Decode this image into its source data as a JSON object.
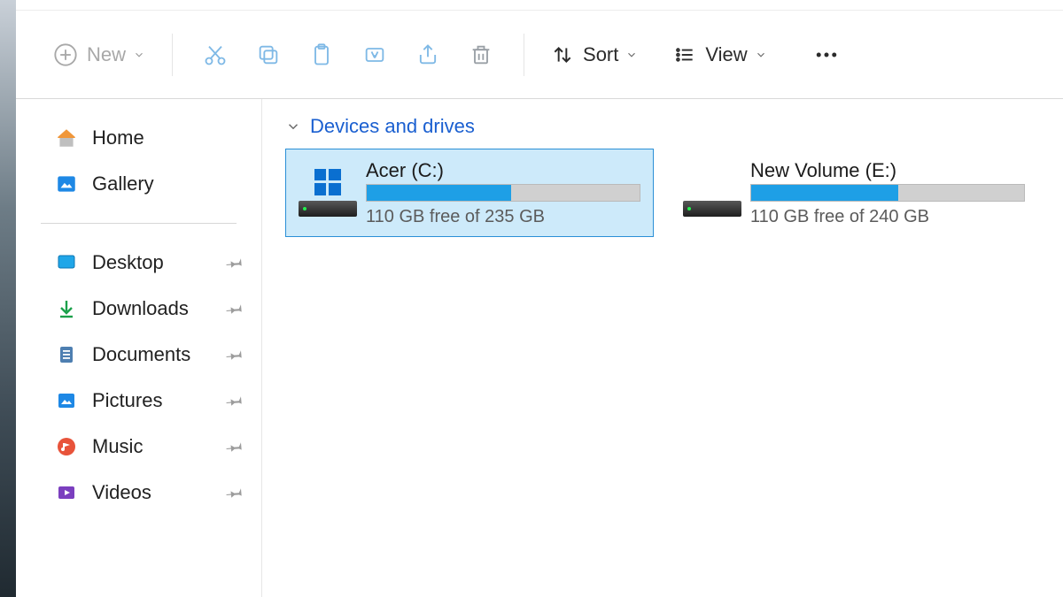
{
  "toolbar": {
    "new_label": "New",
    "sort_label": "Sort",
    "view_label": "View"
  },
  "sidebar": {
    "top": [
      {
        "label": "Home"
      },
      {
        "label": "Gallery"
      }
    ],
    "pinned": [
      {
        "label": "Desktop"
      },
      {
        "label": "Downloads"
      },
      {
        "label": "Documents"
      },
      {
        "label": "Pictures"
      },
      {
        "label": "Music"
      },
      {
        "label": "Videos"
      }
    ]
  },
  "content": {
    "group_title": "Devices and drives",
    "drives": [
      {
        "name": "Acer (C:)",
        "status": "110 GB free of 235 GB",
        "used_pct": 53,
        "selected": true,
        "os": true
      },
      {
        "name": "New Volume (E:)",
        "status": "110 GB free of 240 GB",
        "used_pct": 54,
        "selected": false,
        "os": false
      }
    ]
  }
}
